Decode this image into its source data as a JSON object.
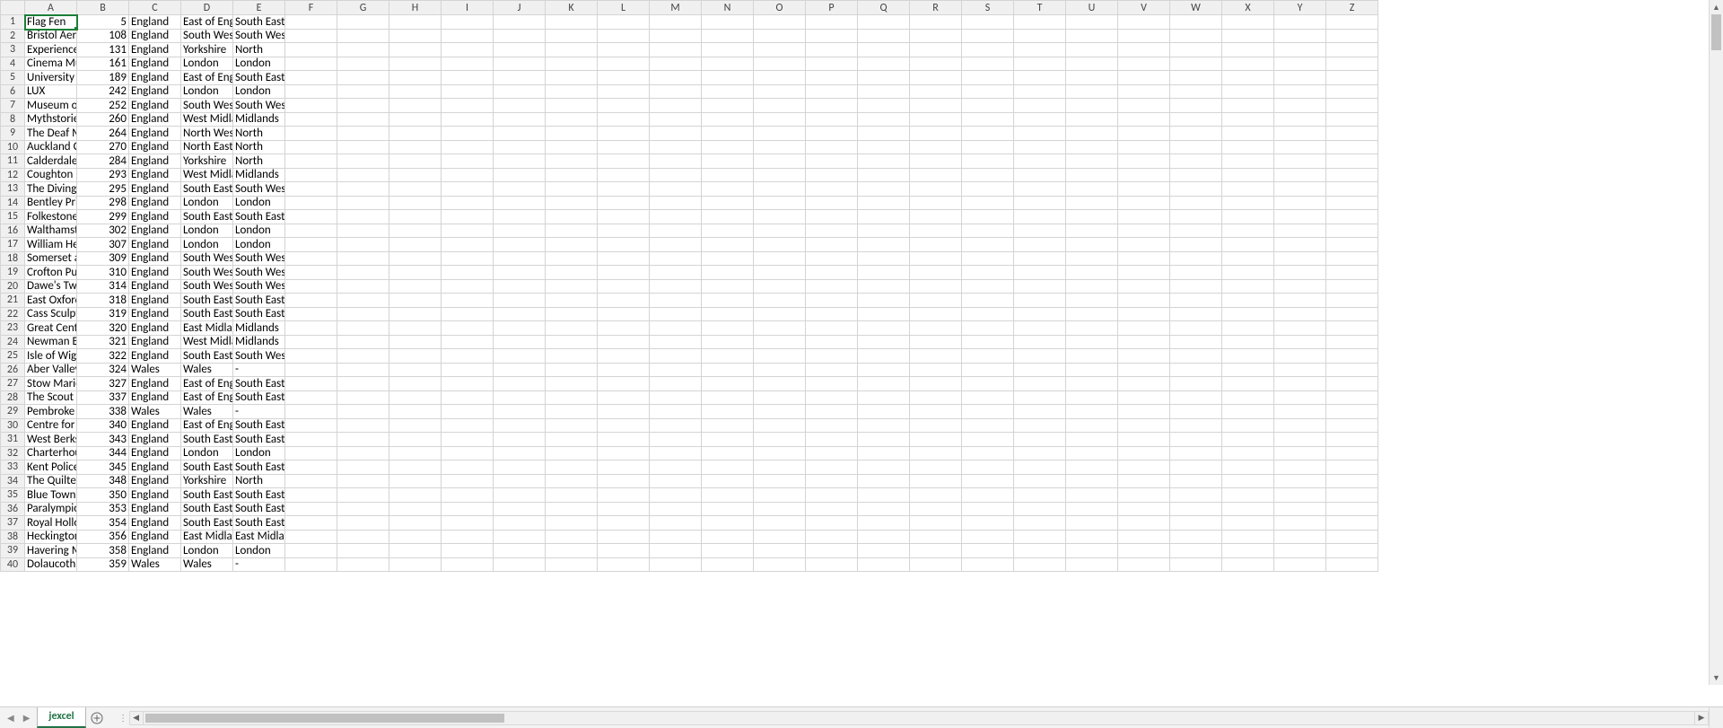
{
  "sheet": {
    "active_tab": "jexcel"
  },
  "columns": [
    "A",
    "B",
    "C",
    "D",
    "E",
    "F",
    "G",
    "H",
    "I",
    "J",
    "K",
    "L",
    "M",
    "N",
    "O",
    "P",
    "Q",
    "R",
    "S",
    "T",
    "U",
    "V",
    "W",
    "X",
    "Y",
    "Z"
  ],
  "col_count_visible": 26,
  "row_count_visible": 40,
  "selected": {
    "row": 1,
    "col": 1
  },
  "rows": [
    {
      "n": 1,
      "a": "Flag Fen",
      "b": 5,
      "c": "England",
      "d": "East of England",
      "e": "South East"
    },
    {
      "n": 2,
      "a": "Bristol Aero",
      "b": 108,
      "c": "England",
      "d": "South West",
      "e": "South West"
    },
    {
      "n": 3,
      "a": "Experience",
      "b": 131,
      "c": "England",
      "d": "Yorkshire",
      "e": "North"
    },
    {
      "n": 4,
      "a": "Cinema Museum",
      "b": 161,
      "c": "England",
      "d": "London",
      "e": "London"
    },
    {
      "n": 5,
      "a": "University of",
      "b": 189,
      "c": "England",
      "d": "East of England",
      "e": "South East"
    },
    {
      "n": 6,
      "a": "LUX",
      "b": 242,
      "c": "England",
      "d": "London",
      "e": "London"
    },
    {
      "n": 7,
      "a": "Museum of",
      "b": 252,
      "c": "England",
      "d": "South West",
      "e": "South West"
    },
    {
      "n": 8,
      "a": "Mythstories",
      "b": 260,
      "c": "England",
      "d": "West Midlands",
      "e": "Midlands"
    },
    {
      "n": 9,
      "a": "The Deaf Museum",
      "b": 264,
      "c": "England",
      "d": "North West",
      "e": "North"
    },
    {
      "n": 10,
      "a": "Auckland Castle",
      "b": 270,
      "c": "England",
      "d": "North East",
      "e": "North"
    },
    {
      "n": 11,
      "a": "Calderdale",
      "b": 284,
      "c": "England",
      "d": "Yorkshire",
      "e": "North"
    },
    {
      "n": 12,
      "a": "Coughton",
      "b": 293,
      "c": "England",
      "d": "West Midlands",
      "e": "Midlands"
    },
    {
      "n": 13,
      "a": "The Diving",
      "b": 295,
      "c": "England",
      "d": "South East",
      "e": "South West"
    },
    {
      "n": 14,
      "a": "Bentley Priory",
      "b": 298,
      "c": "England",
      "d": "London",
      "e": "London"
    },
    {
      "n": 15,
      "a": "Folkestone",
      "b": 299,
      "c": "England",
      "d": "South East",
      "e": "South East"
    },
    {
      "n": 16,
      "a": "Walthamstow",
      "b": 302,
      "c": "England",
      "d": "London",
      "e": "London"
    },
    {
      "n": 17,
      "a": "William Herschel",
      "b": 307,
      "c": "England",
      "d": "London",
      "e": "London"
    },
    {
      "n": 18,
      "a": "Somerset and",
      "b": 309,
      "c": "England",
      "d": "South West",
      "e": "South West"
    },
    {
      "n": 19,
      "a": "Crofton Pumping",
      "b": 310,
      "c": "England",
      "d": "South West",
      "e": "South West"
    },
    {
      "n": 20,
      "a": "Dawe's Twineworks",
      "b": 314,
      "c": "England",
      "d": "South West",
      "e": "South West"
    },
    {
      "n": 21,
      "a": "East Oxford",
      "b": 318,
      "c": "England",
      "d": "South East",
      "e": "South East"
    },
    {
      "n": 22,
      "a": "Cass Sculpture",
      "b": 319,
      "c": "England",
      "d": "South East",
      "e": "South East"
    },
    {
      "n": 23,
      "a": "Great Central",
      "b": 320,
      "c": "England",
      "d": "East Midlands",
      "e": "Midlands"
    },
    {
      "n": 24,
      "a": "Newman Brothers",
      "b": 321,
      "c": "England",
      "d": "West Midlands",
      "e": "Midlands"
    },
    {
      "n": 25,
      "a": "Isle of Wight",
      "b": 322,
      "c": "England",
      "d": "South East",
      "e": "South West"
    },
    {
      "n": 26,
      "a": "Aber Valley",
      "b": 324,
      "c": "Wales",
      "d": "Wales",
      "e": "-"
    },
    {
      "n": 27,
      "a": "Stow Maries",
      "b": 327,
      "c": "England",
      "d": "East of England",
      "e": "South East"
    },
    {
      "n": 28,
      "a": "The Scout",
      "b": 337,
      "c": "England",
      "d": "East of England",
      "e": "South East"
    },
    {
      "n": 29,
      "a": "Pembroke",
      "b": 338,
      "c": "Wales",
      "d": "Wales",
      "e": "-"
    },
    {
      "n": 30,
      "a": "Centre for",
      "b": 340,
      "c": "England",
      "d": "East of England",
      "e": "South East"
    },
    {
      "n": 31,
      "a": "West Berkshire",
      "b": 343,
      "c": "England",
      "d": "South East",
      "e": "South East"
    },
    {
      "n": 32,
      "a": "Charterhouse",
      "b": 344,
      "c": "England",
      "d": "London",
      "e": "London"
    },
    {
      "n": 33,
      "a": "Kent Police",
      "b": 345,
      "c": "England",
      "d": "South East",
      "e": "South East"
    },
    {
      "n": 34,
      "a": "The Quilters",
      "b": 348,
      "c": "England",
      "d": "Yorkshire",
      "e": "North"
    },
    {
      "n": 35,
      "a": "Blue Town",
      "b": 350,
      "c": "England",
      "d": "South East",
      "e": "South East"
    },
    {
      "n": 36,
      "a": "Paralympic",
      "b": 353,
      "c": "England",
      "d": "South East",
      "e": "South East"
    },
    {
      "n": 37,
      "a": "Royal Holloway",
      "b": 354,
      "c": "England",
      "d": "South East",
      "e": "South East"
    },
    {
      "n": 38,
      "a": "Heckington",
      "b": 356,
      "c": "England",
      "d": "East Midlands",
      "e": "East Midlands"
    },
    {
      "n": 39,
      "a": "Havering Museum",
      "b": 358,
      "c": "England",
      "d": "London",
      "e": "London"
    },
    {
      "n": 40,
      "a": "Dolaucothi",
      "b": 359,
      "c": "Wales",
      "d": "Wales",
      "e": "-"
    }
  ]
}
